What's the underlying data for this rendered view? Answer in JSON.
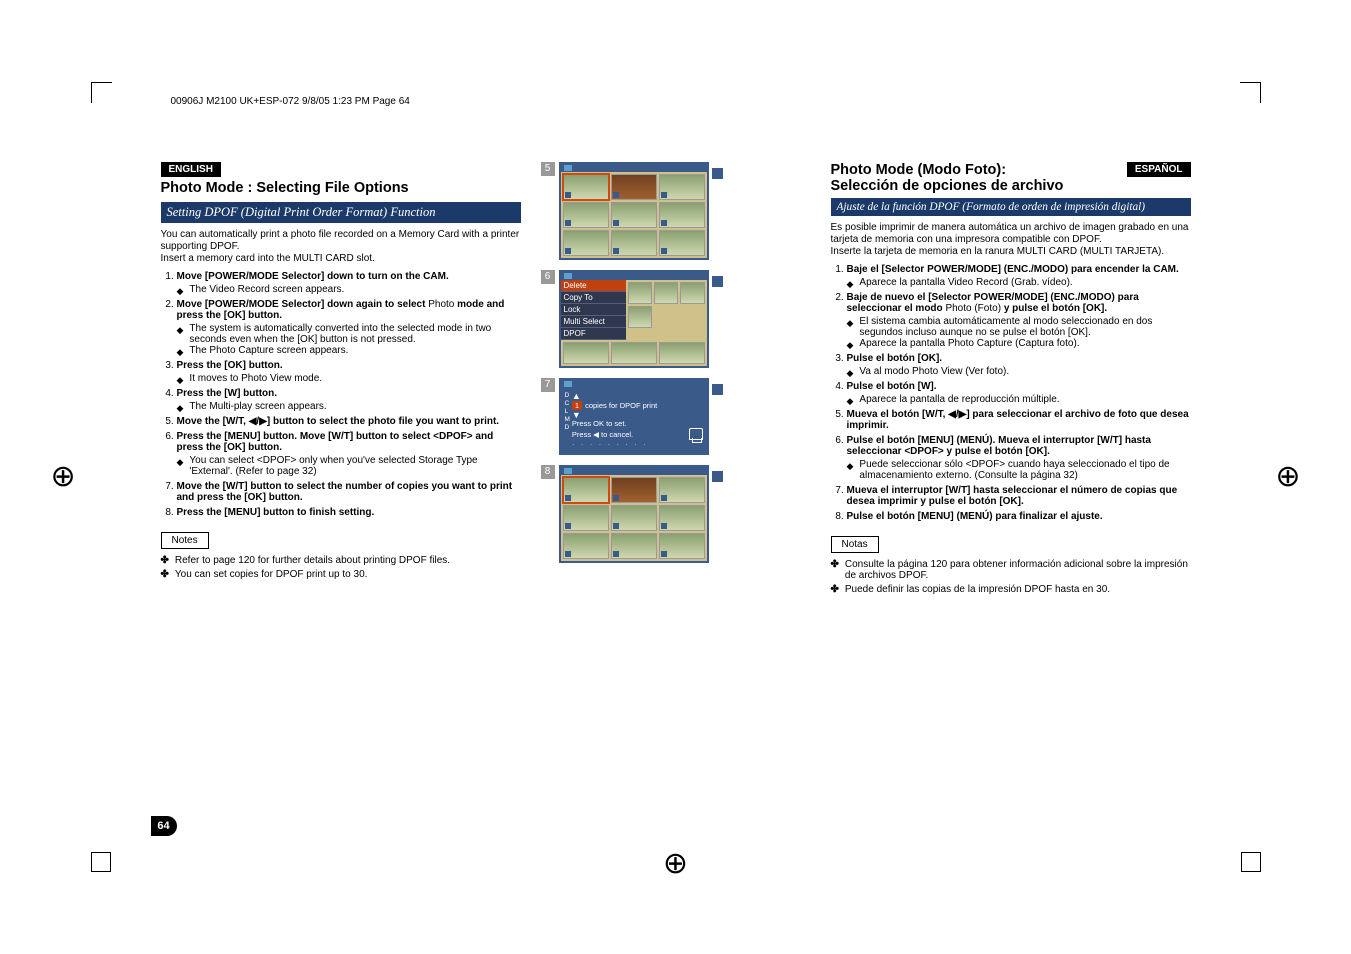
{
  "header_line": "00906J M2100 UK+ESP-072  9/8/05 1:23 PM  Page 64",
  "page_number": "64",
  "left": {
    "lang": "ENGLISH",
    "title": "Photo Mode : Selecting File Options",
    "bluebar": "Setting DPOF (Digital Print Order Format) Function",
    "intro1": "You can automatically print a photo file recorded on a Memory Card with a printer supporting DPOF.",
    "intro2": "Insert a memory card into the MULTI CARD slot.",
    "steps": [
      {
        "n": "1.",
        "label": "Move [POWER/MODE Selector] down to turn on the CAM.",
        "subs": [
          "The Video Record screen appears."
        ]
      },
      {
        "n": "2.",
        "label_parts": [
          "Move [POWER/MODE Selector] down again to select ",
          "Photo",
          " mode and press the [OK] button."
        ],
        "subs": [
          "The system is automatically converted into the selected mode in two seconds even when the [OK] button is not pressed.",
          "The Photo Capture screen appears."
        ]
      },
      {
        "n": "3.",
        "label": "Press the [OK] button.",
        "subs": [
          "It moves to Photo View mode."
        ]
      },
      {
        "n": "4.",
        "label": "Press the [W] button.",
        "subs": [
          "The Multi-play screen appears."
        ]
      },
      {
        "n": "5.",
        "label": "Move the [W/T, ◀/▶] button to select the photo file you want to print."
      },
      {
        "n": "6.",
        "label": "Press the [MENU] button. Move [W/T] button to select <DPOF> and press the [OK] button.",
        "subs": [
          "You can select <DPOF> only when you've selected Storage Type 'External'. (Refer to page 32)"
        ]
      },
      {
        "n": "7.",
        "label": "Move the [W/T] button to select the number of copies you want to print and press the [OK] button."
      },
      {
        "n": "8.",
        "label": "Press the [MENU] button to finish setting."
      }
    ],
    "notes_label": "Notes",
    "notes": [
      "Refer to page 120 for further details about printing DPOF files.",
      "You can set copies for DPOF print up to 30."
    ]
  },
  "right": {
    "lang": "ESPAÑOL",
    "title1": "Photo Mode (Modo Foto):",
    "title2": "Selección de opciones de archivo",
    "bluebar": "Ajuste de la función DPOF (Formato de orden de impresión digital)",
    "intro1": "Es posible imprimir de manera automática un archivo de imagen grabado en una tarjeta de memoria con una impresora compatible con DPOF.",
    "intro2": "Inserte la tarjeta de memoria en la ranura MULTI CARD (MULTI TARJETA).",
    "steps": [
      {
        "n": "1.",
        "label": "Baje el [Selector POWER/MODE] (ENC./MODO) para encender la CAM.",
        "subs": [
          "Aparece la pantalla Video Record (Grab. vídeo)."
        ]
      },
      {
        "n": "2.",
        "label_parts": [
          "Baje de nuevo el [Selector POWER/MODE] (ENC./MODO) para seleccionar el modo ",
          "Photo",
          " (Foto) ",
          "y pulse el botón [OK]."
        ],
        "subs": [
          "El sistema cambia automáticamente al modo seleccionado en dos segundos incluso aunque no se pulse el botón [OK].",
          "Aparece la pantalla Photo Capture (Captura foto)."
        ]
      },
      {
        "n": "3.",
        "label": "Pulse el botón [OK].",
        "subs": [
          "Va al modo Photo View (Ver foto)."
        ]
      },
      {
        "n": "4.",
        "label": "Pulse el botón [W].",
        "subs": [
          "Aparece la pantalla de reproducción múltiple."
        ]
      },
      {
        "n": "5.",
        "label": "Mueva el botón [W/T, ◀/▶] para seleccionar el archivo de foto que desea imprimir."
      },
      {
        "n": "6.",
        "label": "Pulse el botón [MENU] (MENÚ). Mueva el interruptor [W/T] hasta seleccionar <DPOF> y pulse el botón [OK].",
        "subs": [
          "Puede seleccionar sólo <DPOF> cuando haya seleccionado el tipo de almacenamiento externo. (Consulte la página 32)"
        ]
      },
      {
        "n": "7.",
        "label": "Mueva el interruptor [W/T] hasta seleccionar el número de copias que desea imprimir y pulse el botón [OK]."
      },
      {
        "n": "8.",
        "label": "Pulse el botón [MENU] (MENÚ) para finalizar el ajuste."
      }
    ],
    "notes_label": "Notas",
    "notes": [
      "Consulte la página 120 para obtener información adicional sobre la impresión de archivos DPOF.",
      "Puede definir las copias de la impresión DPOF hasta en 30."
    ]
  },
  "center": {
    "nums": [
      "5",
      "6",
      "7",
      "8"
    ],
    "menu_items": [
      "Delete",
      "Copy To",
      "Lock",
      "Multi Select",
      "DPOF"
    ],
    "dpof_letters": [
      "D",
      "C",
      "L",
      "M",
      "D"
    ],
    "dpof_copies_num": "1",
    "dpof_copies_label": "copies for DPOF print",
    "dpof_ok": "Press OK to set.",
    "dpof_cancel": "Press ◀ to cancel."
  }
}
